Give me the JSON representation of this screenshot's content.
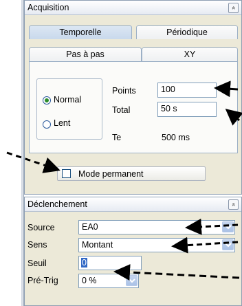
{
  "acquisition": {
    "title": "Acquisition",
    "collapse_glyph": "»",
    "tabs_row1": [
      "Temporelle",
      "Périodique"
    ],
    "tabs_row2": [
      "Pas à pas",
      "XY"
    ],
    "mode_normal": "Normal",
    "mode_lent": "Lent",
    "points_label": "Points",
    "points_value": "100",
    "total_label": "Total",
    "total_value": "50 s",
    "te_label": "Te",
    "te_value": "500 ms",
    "mode_permanent": "Mode permanent",
    "selected_mode": "Normal",
    "mode_permanent_checked": false
  },
  "declenchement": {
    "title": "Déclenchement",
    "collapse_glyph": "»",
    "source_label": "Source",
    "source_value": "EA0",
    "sens_label": "Sens",
    "sens_value": "Montant",
    "seuil_label": "Seuil",
    "seuil_value": "0",
    "pretrig_label": "Pré-Trig",
    "pretrig_value": "0 %"
  },
  "colors": {
    "panel_bg": "#ece9d8",
    "accent": "#2a8c2a",
    "dropdown": "#a9c1e6"
  }
}
